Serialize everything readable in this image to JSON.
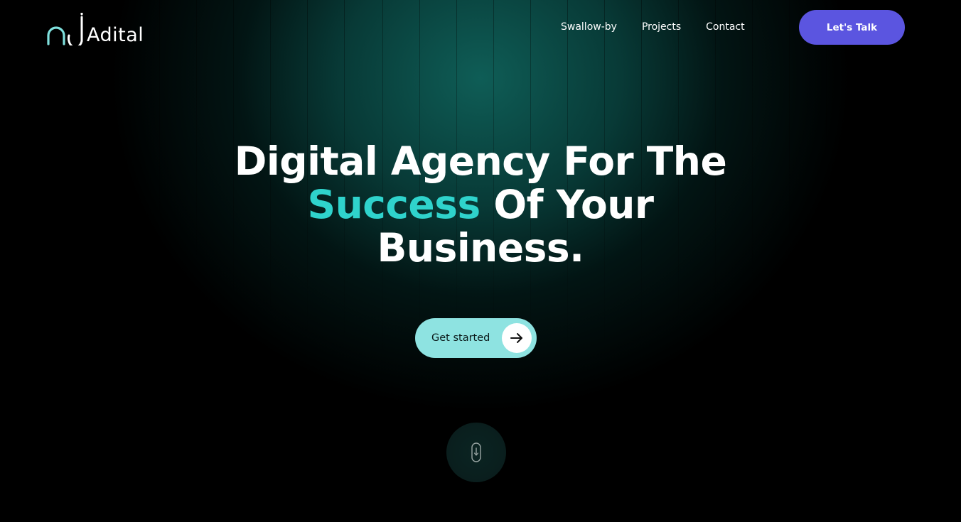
{
  "brand": {
    "name": "Adital",
    "logo_icon": "aj-monogram-icon",
    "accent_color": "#2fd3cc"
  },
  "nav": {
    "items": [
      "Swallow-by",
      "Projects",
      "Contact"
    ],
    "cta_label": "Let's Talk",
    "cta_color": "#5b55e0"
  },
  "hero": {
    "title_line1": "Digital Agency For The",
    "title_accent": "Success",
    "title_line2_rest": " Of Your",
    "title_line3": "Business.",
    "button_label": "Get started",
    "button_icon": "arrow-right-icon",
    "button_color": "#8ee3e1"
  },
  "scroll": {
    "icon": "mouse-scroll-icon"
  }
}
